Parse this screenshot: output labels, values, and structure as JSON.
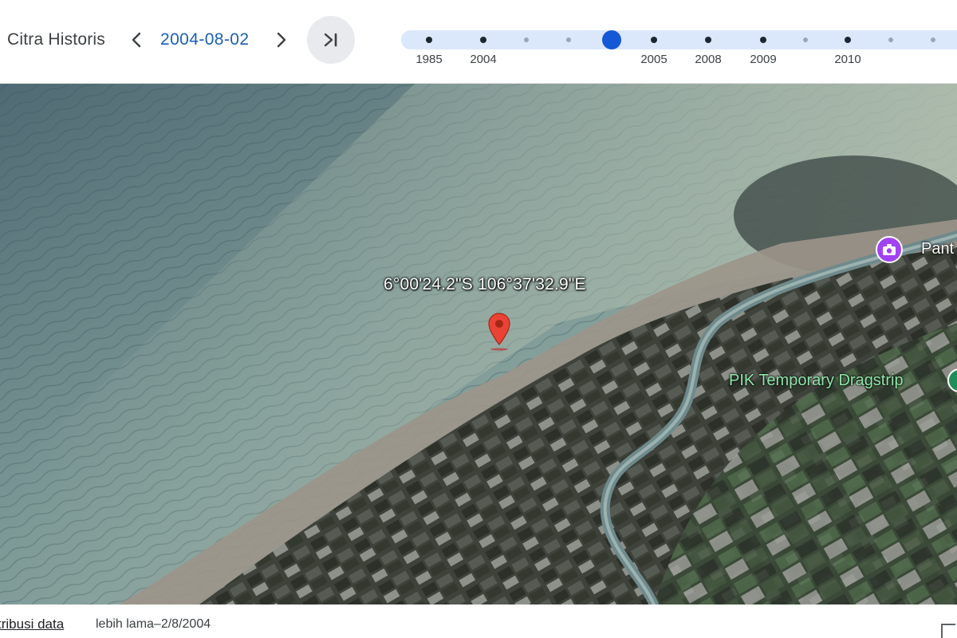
{
  "toolbar": {
    "title": "Citra Historis",
    "date": "2004-08-02",
    "prev_icon": "chevron-left-icon",
    "next_icon": "chevron-right-icon",
    "latest_icon": "skip-to-latest-icon"
  },
  "timeline": {
    "selected_year_index": 4,
    "year_labels": [
      "1985",
      "2004",
      "2005",
      "2008",
      "2009",
      "2010"
    ],
    "accent_color": "#1558d6",
    "track_color": "#dbe7fb"
  },
  "map": {
    "coordinates": "6°00'24.2\"S 106°37'32.9\"E",
    "places": {
      "pik": "PIK Temporary Dragstrip",
      "pantai": "Pant"
    },
    "marker_icon": "map-pin-icon",
    "poi_icon": "camera-icon"
  },
  "footer": {
    "attribution": "tribusi data",
    "older": "lebih lama–2/8/2004"
  }
}
